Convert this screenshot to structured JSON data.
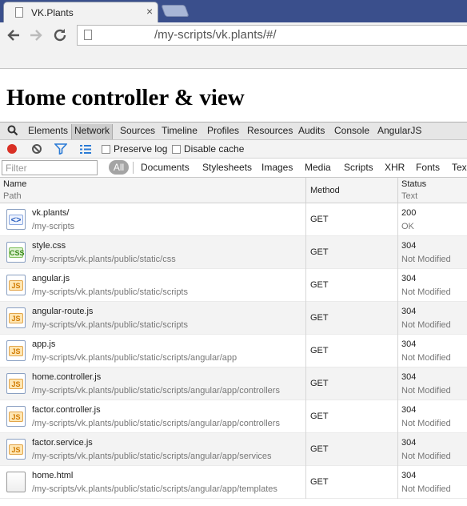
{
  "browser": {
    "tab_title": "VK.Plants",
    "tab_close": "×",
    "address_url": "/my-scripts/vk.plants/#/"
  },
  "page": {
    "title": "Home controller & view"
  },
  "devtools": {
    "tabs": [
      "Elements",
      "Network",
      "Sources",
      "Timeline",
      "Profiles",
      "Resources",
      "Audits",
      "Console",
      "AngularJS"
    ],
    "active_tab": "Network",
    "controls": {
      "preserve_log": "Preserve log",
      "disable_cache": "Disable cache"
    },
    "filter": {
      "placeholder": "Filter",
      "all": "All",
      "types": [
        "Documents",
        "Stylesheets",
        "Images",
        "Media",
        "Scripts",
        "XHR",
        "Fonts",
        "Tex"
      ]
    },
    "columns": {
      "name": "Name",
      "path": "Path",
      "method": "Method",
      "status": "Status",
      "text": "Text"
    },
    "requests": [
      {
        "icon": "html",
        "name": "vk.plants/",
        "path": "/my-scripts",
        "method": "GET",
        "status": "200",
        "status_text": "OK"
      },
      {
        "icon": "css",
        "name": "style.css",
        "path": "/my-scripts/vk.plants/public/static/css",
        "method": "GET",
        "status": "304",
        "status_text": "Not Modified"
      },
      {
        "icon": "js",
        "name": "angular.js",
        "path": "/my-scripts/vk.plants/public/static/scripts",
        "method": "GET",
        "status": "304",
        "status_text": "Not Modified"
      },
      {
        "icon": "js",
        "name": "angular-route.js",
        "path": "/my-scripts/vk.plants/public/static/scripts",
        "method": "GET",
        "status": "304",
        "status_text": "Not Modified"
      },
      {
        "icon": "js",
        "name": "app.js",
        "path": "/my-scripts/vk.plants/public/static/scripts/angular/app",
        "method": "GET",
        "status": "304",
        "status_text": "Not Modified"
      },
      {
        "icon": "js",
        "name": "home.controller.js",
        "path": "/my-scripts/vk.plants/public/static/scripts/angular/app/controllers",
        "method": "GET",
        "status": "304",
        "status_text": "Not Modified"
      },
      {
        "icon": "js",
        "name": "factor.controller.js",
        "path": "/my-scripts/vk.plants/public/static/scripts/angular/app/controllers",
        "method": "GET",
        "status": "304",
        "status_text": "Not Modified"
      },
      {
        "icon": "js",
        "name": "factor.service.js",
        "path": "/my-scripts/vk.plants/public/static/scripts/angular/app/services",
        "method": "GET",
        "status": "304",
        "status_text": "Not Modified"
      },
      {
        "icon": "plain",
        "name": "home.html",
        "path": "/my-scripts/vk.plants/public/static/scripts/angular/app/templates",
        "method": "GET",
        "status": "304",
        "status_text": "Not Modified"
      }
    ],
    "icon_labels": {
      "html": "<>",
      "css": "CSS",
      "js": "JS",
      "plain": ""
    }
  }
}
